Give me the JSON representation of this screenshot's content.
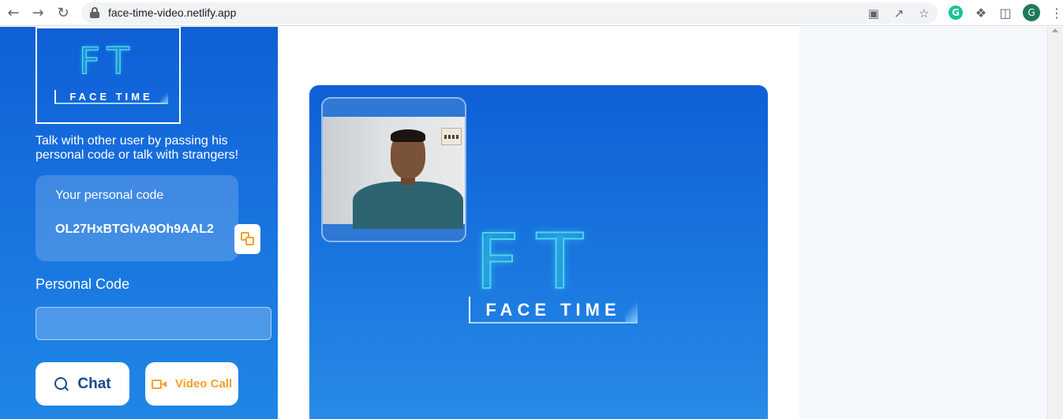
{
  "browser": {
    "url": "face-time-video.netlify.app",
    "profile_initial": "G",
    "grammarly_initial": "G",
    "icons": [
      "back-arrow-icon",
      "forward-arrow-icon",
      "reload-icon",
      "lock-icon",
      "camera-icon",
      "share-icon",
      "star-icon",
      "puzzle-icon",
      "sidebar-icon",
      "kebab-menu-icon"
    ]
  },
  "sidebar": {
    "logo": {
      "letters": "FT",
      "word": "FACE TIME"
    },
    "tagline": "Talk with other user by passing his personal code or talk with strangers!",
    "personal_code_card": {
      "label": "Your personal code",
      "value": "OL27HxBTGlvA9Oh9AAL2"
    },
    "personal_code_field": {
      "label": "Personal Code",
      "value": "",
      "placeholder": ""
    },
    "buttons": {
      "chat": "Chat",
      "video_call": "Video Call"
    }
  },
  "main": {
    "remote_logo": {
      "letters": "FT",
      "word": "FACE TIME"
    }
  },
  "colors": {
    "primary_blue": "#0f5fd6",
    "accent_orange": "#f2a12b",
    "chat_text": "#174a8b",
    "logo_cyan": "#46d8e8"
  }
}
